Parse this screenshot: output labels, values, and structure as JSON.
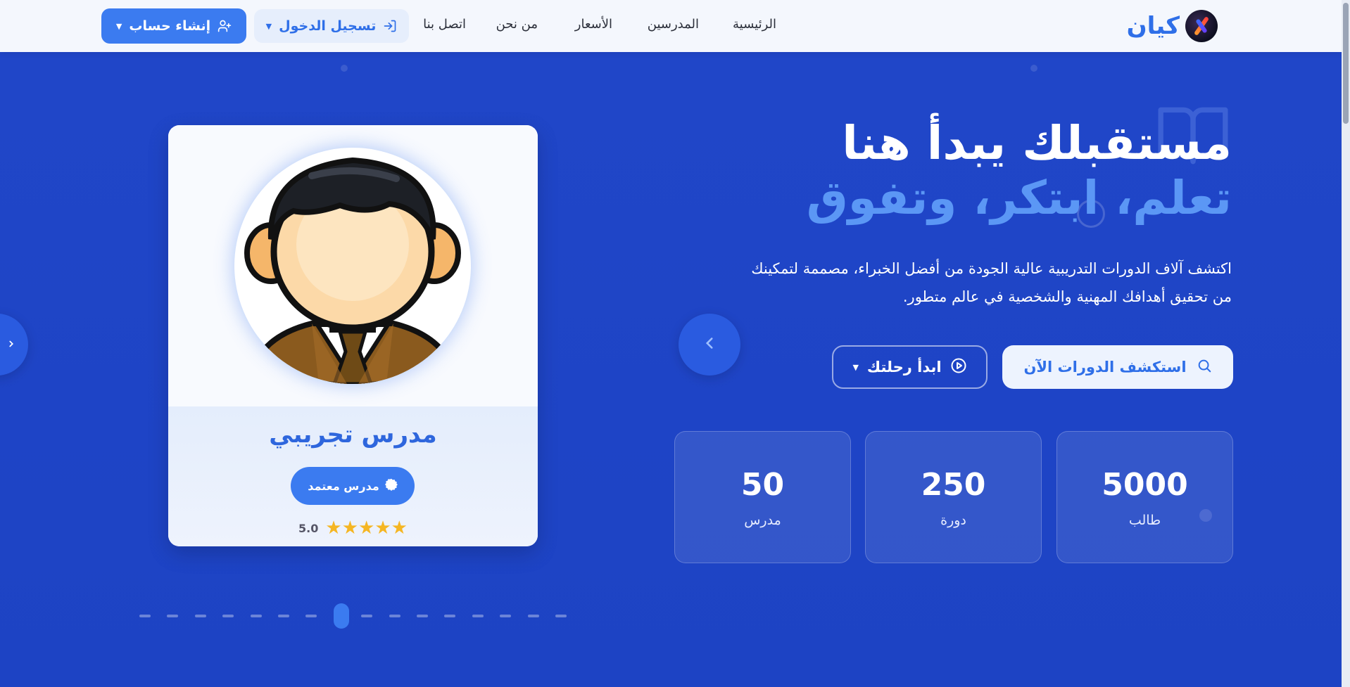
{
  "brand": {
    "name": "كيان"
  },
  "nav": {
    "links": [
      "الرئيسية",
      "المدرسين",
      "الأسعار",
      "من نحن",
      "اتصل بنا"
    ],
    "login_label": "تسجيل الدخول",
    "register_label": "إنشاء حساب"
  },
  "hero": {
    "title": "مستقبلك يبدأ هنا",
    "subtitle": "تعلم، ابتكر، وتفوق",
    "description_line1": "اكتشف آلاف الدورات التدريبية عالية الجودة من أفضل الخبراء، مصممة لتمكينك",
    "description_line2": "من تحقيق أهدافك المهنية والشخصية في عالم متطور.",
    "explore_label": "استكشف الدورات الآن",
    "journey_label": "ابدأ رحلتك",
    "stats": [
      {
        "value": "5000",
        "label": "طالب"
      },
      {
        "value": "250",
        "label": "دورة"
      },
      {
        "value": "50",
        "label": "مدرس"
      }
    ]
  },
  "teacher_card": {
    "name": "مدرس تجريبي",
    "badge": "مدرس معتمد",
    "rating": "5.0",
    "stars": 5
  },
  "carousel": {
    "total_dots": 16,
    "active_index": 7
  },
  "colors": {
    "accent": "#3b7bf0",
    "hero_bg": "#1f46c9",
    "subtitle": "#5b97f5",
    "star": "#f5b623"
  }
}
